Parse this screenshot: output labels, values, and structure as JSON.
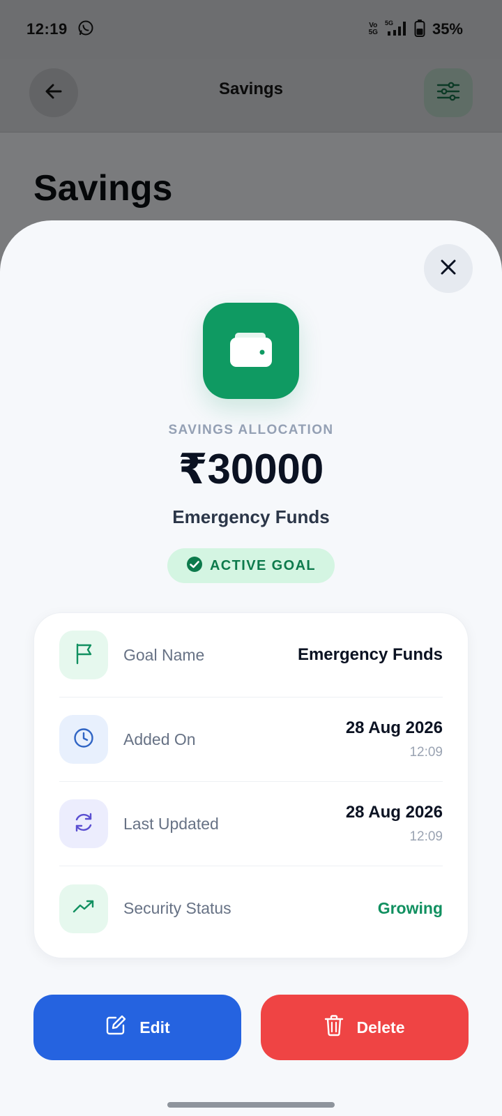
{
  "status_bar": {
    "time": "12:19",
    "net_top": "Vo",
    "net_bottom": "5G",
    "signal_label": "5G",
    "battery": "35%"
  },
  "header": {
    "title": "Savings"
  },
  "page": {
    "title": "Savings"
  },
  "sheet": {
    "allocation_label": "SAVINGS ALLOCATION",
    "amount": "₹30000",
    "goal_title": "Emergency Funds",
    "badge": "ACTIVE GOAL",
    "details": {
      "goal_name_label": "Goal Name",
      "goal_name_value": "Emergency Funds",
      "added_on_label": "Added On",
      "added_on_date": "28 Aug 2026",
      "added_on_time": "12:09",
      "last_updated_label": "Last Updated",
      "last_updated_date": "28 Aug 2026",
      "last_updated_time": "12:09",
      "security_label": "Security Status",
      "security_value": "Growing"
    },
    "actions": {
      "edit": "Edit",
      "delete": "Delete"
    }
  },
  "colors": {
    "accent_green": "#0f9a62",
    "edit_blue": "#2563e0",
    "delete_red": "#ef4444",
    "status_green": "#119060"
  }
}
